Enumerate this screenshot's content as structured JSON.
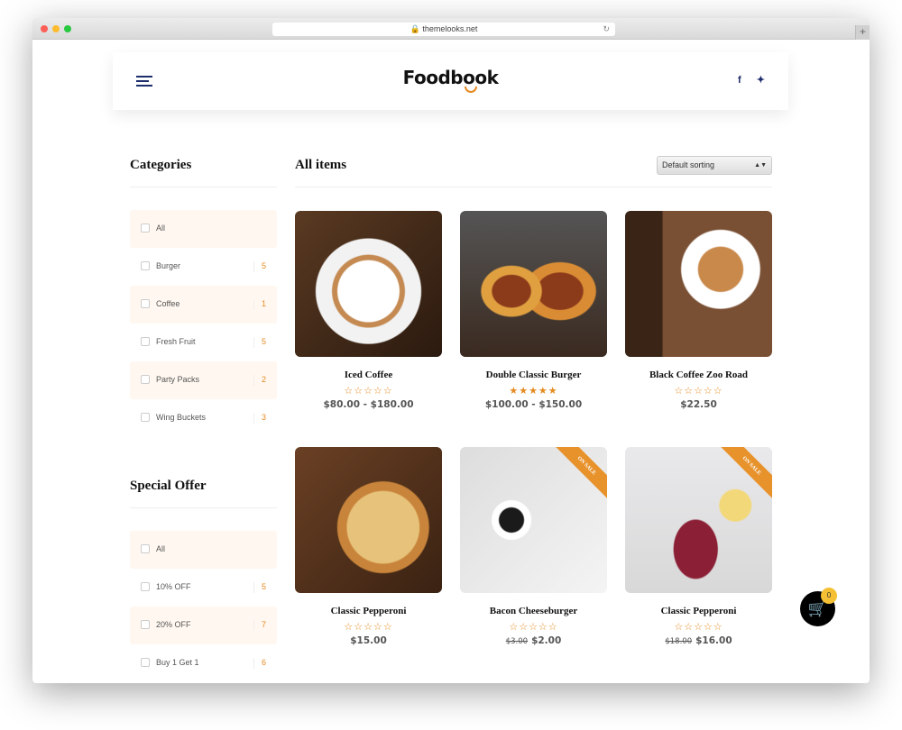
{
  "browser": {
    "url": "themelooks.net"
  },
  "header": {
    "logo": "Foodbook",
    "social": [
      "f",
      "🐦"
    ]
  },
  "categories": {
    "title": "Categories",
    "items": [
      {
        "label": "All",
        "count": ""
      },
      {
        "label": "Burger",
        "count": "5"
      },
      {
        "label": "Coffee",
        "count": "1"
      },
      {
        "label": "Fresh Fruit",
        "count": "5"
      },
      {
        "label": "Party Packs",
        "count": "2"
      },
      {
        "label": "Wing Buckets",
        "count": "3"
      }
    ]
  },
  "special_offer": {
    "title": "Special Offer",
    "items": [
      {
        "label": "All",
        "count": ""
      },
      {
        "label": "10% OFF",
        "count": "5"
      },
      {
        "label": "20% OFF",
        "count": "7"
      },
      {
        "label": "Buy 1 Get 1",
        "count": "6"
      }
    ]
  },
  "main": {
    "title": "All items",
    "sort": "Default sorting"
  },
  "products": [
    {
      "name": "Iced Coffee",
      "rating": 0,
      "stars": "☆☆☆☆☆",
      "old_price": "",
      "price": "$80.00 - $180.00",
      "sale": ""
    },
    {
      "name": "Double Classic Burger",
      "rating": 5,
      "stars": "★★★★★",
      "old_price": "",
      "price": "$100.00 - $150.00",
      "sale": ""
    },
    {
      "name": "Black Coffee Zoo Road",
      "rating": 0,
      "stars": "☆☆☆☆☆",
      "old_price": "",
      "price": "$22.50",
      "sale": ""
    },
    {
      "name": "Classic Pepperoni",
      "rating": 0,
      "stars": "☆☆☆☆☆",
      "old_price": "",
      "price": "$15.00",
      "sale": ""
    },
    {
      "name": "Bacon Cheeseburger",
      "rating": 0,
      "stars": "☆☆☆☆☆",
      "old_price": "$3.00",
      "price": "$2.00",
      "sale": "ON SALE"
    },
    {
      "name": "Classic Pepperoni",
      "rating": 0,
      "stars": "☆☆☆☆☆",
      "old_price": "$18.00",
      "price": "$16.00",
      "sale": "ON SALE"
    }
  ],
  "cart": {
    "count": "0",
    "icon": "cart-icon"
  },
  "colors": {
    "accent": "#e58a1f",
    "navy": "#1d2d6b",
    "filter_bg": "#fff7f0"
  }
}
